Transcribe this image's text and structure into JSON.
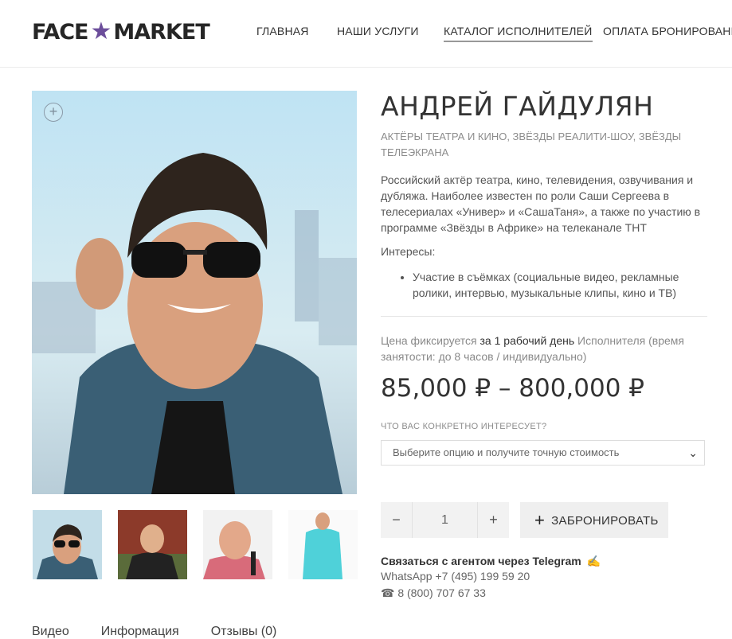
{
  "header": {
    "logo_left": "FACE",
    "logo_right": "MARKET",
    "logo_star": "★",
    "nav": [
      {
        "label": "ГЛАВНАЯ",
        "active": false
      },
      {
        "label": "НАШИ УСЛУГИ",
        "active": false
      },
      {
        "label": "КАТАЛОГ ИСПОЛНИТЕЛЕЙ",
        "active": true
      },
      {
        "label": "ОПЛАТА БРОНИРОВАНИЯ",
        "active": false
      }
    ],
    "brand_color": "#6c4e9b"
  },
  "gallery": {
    "zoom_icon": "+",
    "thumbnails": [
      "thumb-1",
      "thumb-2",
      "thumb-3",
      "thumb-4"
    ]
  },
  "product": {
    "title": "АНДРЕЙ ГАЙДУЛЯН",
    "categories": "АКТЁРЫ ТЕАТРА И КИНО, ЗВЁЗДЫ РЕАЛИТИ-ШОУ, ЗВЁЗДЫ ТЕЛЕЭКРАНА",
    "description": "Российский актёр театра, кино, телевидения, озвучивания и дубляжа. Наиболее известен по роли Саши Сергеева в телесериалах «Универ» и «СашаТаня», а также по участию в программе «Звёзды в Африке» на телеканале ТНТ",
    "interests_label": "Интересы:",
    "interests": [
      "Участие в съёмках (социальные видео, рекламные ролики, интервью, музыкальные клипы, кино и ТВ)"
    ],
    "price_note_pre": "Цена фиксируется ",
    "price_note_bold": "за 1 рабочий день",
    "price_note_post": " Исполнителя (время занятости: до 8 часов / индивидуально)",
    "price": "85,000 ₽ – 800,000 ₽",
    "question_label": "ЧТО ВАС КОНКРЕТНО ИНТЕРЕСУЕТ?",
    "select_placeholder": "Выберите опцию и получите точную стоимость",
    "qty_minus": "−",
    "qty_value": "1",
    "qty_plus": "+",
    "book_plus": "+",
    "book_label": "ЗАБРОНИРОВАТЬ"
  },
  "contacts": {
    "telegram": "Связаться с агентом через Telegram",
    "telegram_icon": "✍",
    "whatsapp": "WhatsApp +7 (495) 199 59 20",
    "phone": "☎ 8 (800) 707 67 33"
  },
  "tabs": [
    "Видео",
    "Информация",
    "Отзывы (0)"
  ]
}
